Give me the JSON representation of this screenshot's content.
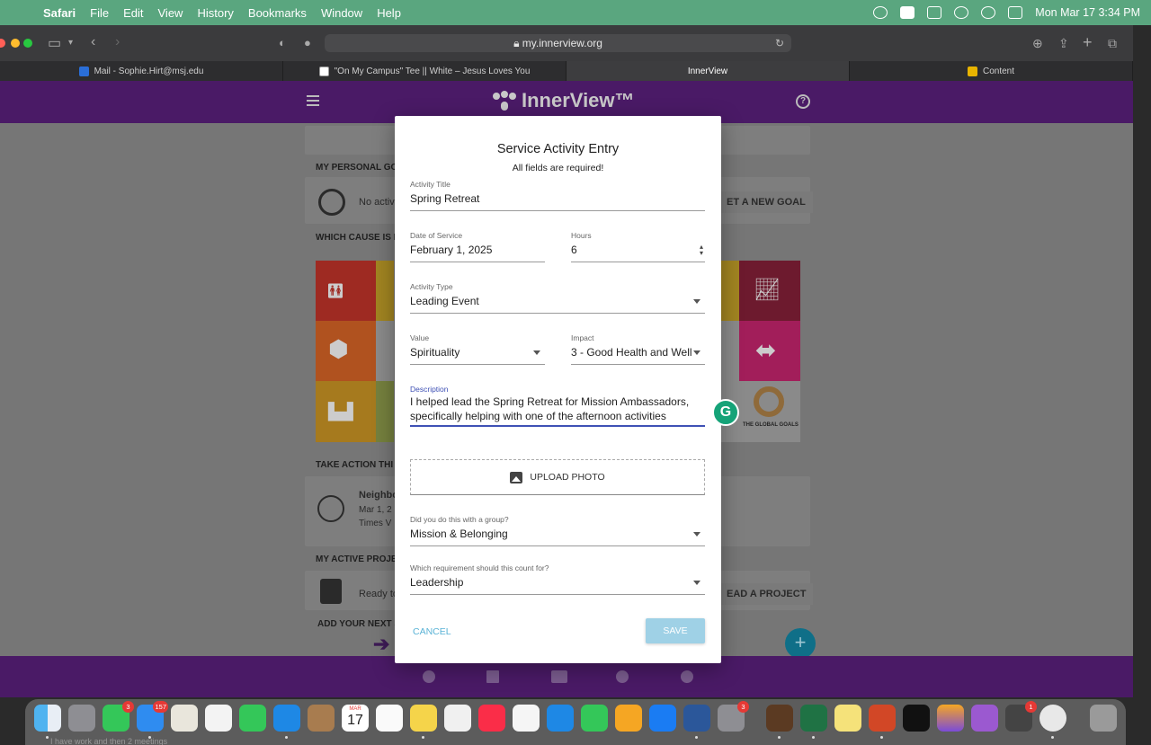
{
  "menubar": {
    "app": "Safari",
    "items": [
      "File",
      "Edit",
      "View",
      "History",
      "Bookmarks",
      "Window",
      "Help"
    ],
    "datetime": "Mon Mar 17  3:34 PM"
  },
  "browser": {
    "url": "my.innerview.org",
    "tabs": [
      {
        "label": "Mail - Sophie.Hirt@msj.edu",
        "active": false
      },
      {
        "label": "\"On My Campus\" Tee || White – Jesus Loves You",
        "active": false
      },
      {
        "label": "InnerView",
        "active": true
      },
      {
        "label": "Content",
        "active": false
      }
    ]
  },
  "app": {
    "logo": "InnerView™",
    "sections": {
      "goal_title": "MY PERSONAL GO",
      "goal_text": "No activ",
      "goal_button": "ET A NEW GOAL",
      "cause_title": "WHICH CAUSE IS I",
      "take_action_title": "TAKE ACTION THI",
      "action_name": "Neighbo",
      "action_date": "Mar 1, 2",
      "action_place": "Times V",
      "projects_title": "MY ACTIVE PROJE",
      "projects_text": "Ready to",
      "projects_button": "EAD A PROJECT",
      "next_title": "ADD YOUR NEXT S",
      "global_goals": "THE GLOBAL GOALS"
    },
    "fab_label": "+"
  },
  "dialog": {
    "title": "Service Activity Entry",
    "subtitle": "All fields are required!",
    "activity_title": {
      "label": "Activity Title",
      "value": "Spring Retreat"
    },
    "date": {
      "label": "Date of Service",
      "value": "February 1, 2025"
    },
    "hours": {
      "label": "Hours",
      "value": "6"
    },
    "activity_type": {
      "label": "Activity Type",
      "value": "Leading Event"
    },
    "value_field": {
      "label": "Value",
      "value": "Spirituality"
    },
    "impact": {
      "label": "Impact",
      "value": "3 - Good Health and Well"
    },
    "description": {
      "label": "Description",
      "line1": "I helped lead the Spring Retreat for Mission Ambassadors,",
      "line2": "specifically helping with one of the afternoon activities"
    },
    "upload_label": "UPLOAD PHOTO",
    "group": {
      "label": "Did you do this with a group?",
      "value": "Mission & Belonging"
    },
    "requirement": {
      "label": "Which requirement should this count for?",
      "value": "Leadership"
    },
    "cancel": "CANCEL",
    "save": "SAVE"
  },
  "dock": {
    "calendar_month": "MAR",
    "calendar_day": "17",
    "badges": {
      "messages": "3",
      "mail": "157",
      "settings": "3",
      "misc": "1"
    }
  },
  "footer_text": "I have work and then 2 meetings"
}
